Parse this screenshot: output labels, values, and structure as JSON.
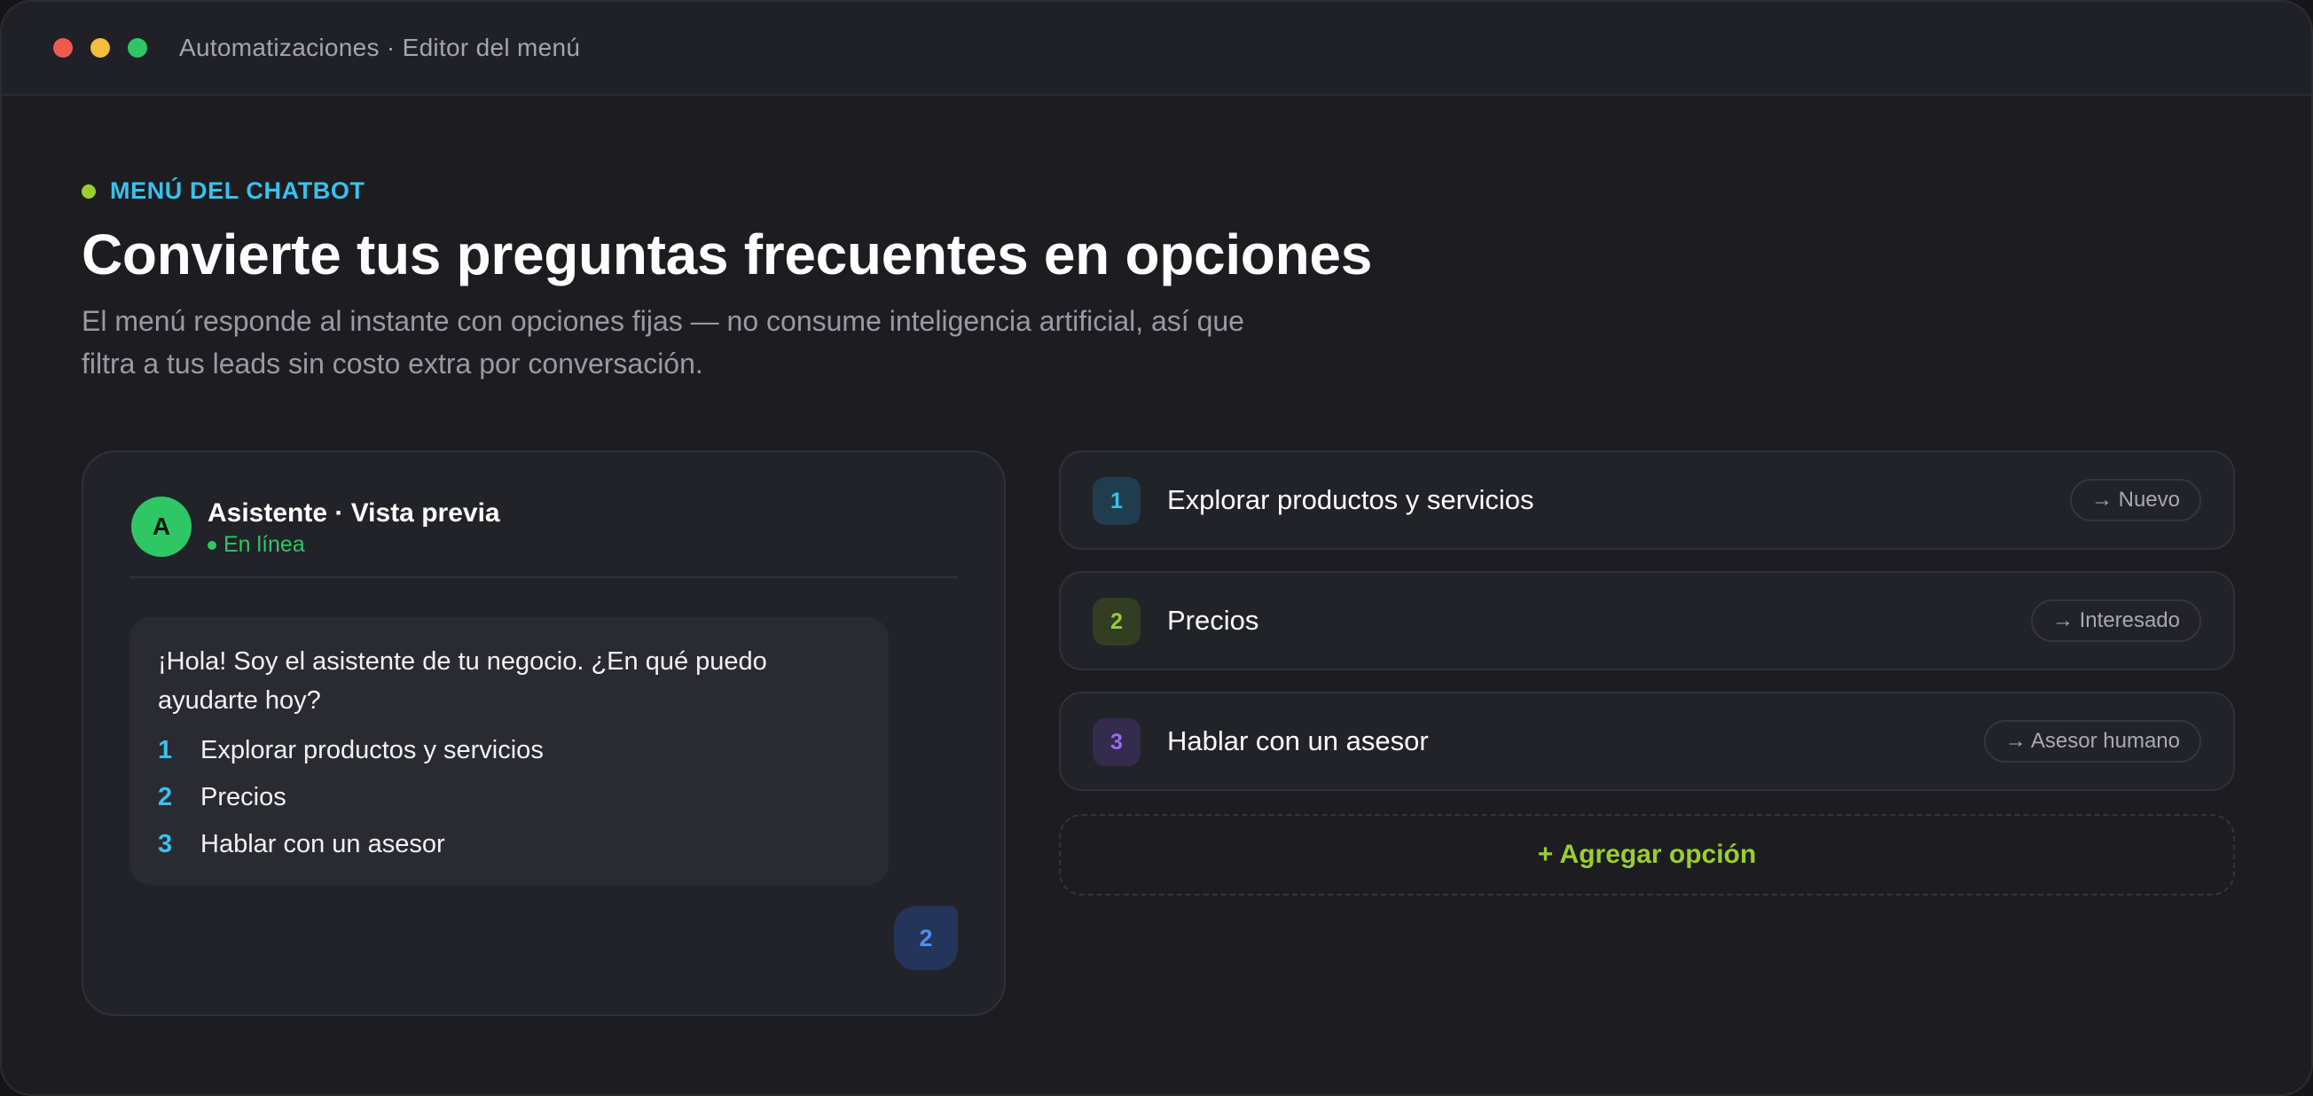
{
  "window": {
    "title": "Automatizaciones · Editor del menú"
  },
  "header": {
    "eyebrow": "MENÚ DEL CHATBOT",
    "title": "Convierte tus preguntas frecuentes en opciones",
    "subtitle": "El menú responde al instante con opciones fijas — no consume inteligencia artificial, así que filtra a tus leads sin costo extra por conversación."
  },
  "preview": {
    "avatar_initial": "A",
    "name": "Asistente · Vista previa",
    "status": "En línea",
    "greeting": "¡Hola! Soy el asistente de tu negocio. ¿En qué puedo ayudarte hoy?",
    "options": [
      {
        "number": "1",
        "label": "Explorar productos y servicios"
      },
      {
        "number": "2",
        "label": "Precios"
      },
      {
        "number": "3",
        "label": "Hablar con un asesor"
      }
    ],
    "user_reply": "2"
  },
  "menu_options": [
    {
      "number": "1",
      "label": "Explorar productos y servicios",
      "destination": "→ Nuevo",
      "color": "#38c2ee"
    },
    {
      "number": "2",
      "label": "Precios",
      "destination": "→ Interesado",
      "color": "#9acd32"
    },
    {
      "number": "3",
      "label": "Hablar con un asesor",
      "destination": "→ Asesor humano",
      "color": "#9b6cf0"
    }
  ],
  "add_option_label": "+ Agregar opción",
  "colors": {
    "accent_cyan": "#38c2ee",
    "accent_lime": "#9acd32",
    "online_green": "#2fc765",
    "window_bg": "#1c1c21"
  }
}
